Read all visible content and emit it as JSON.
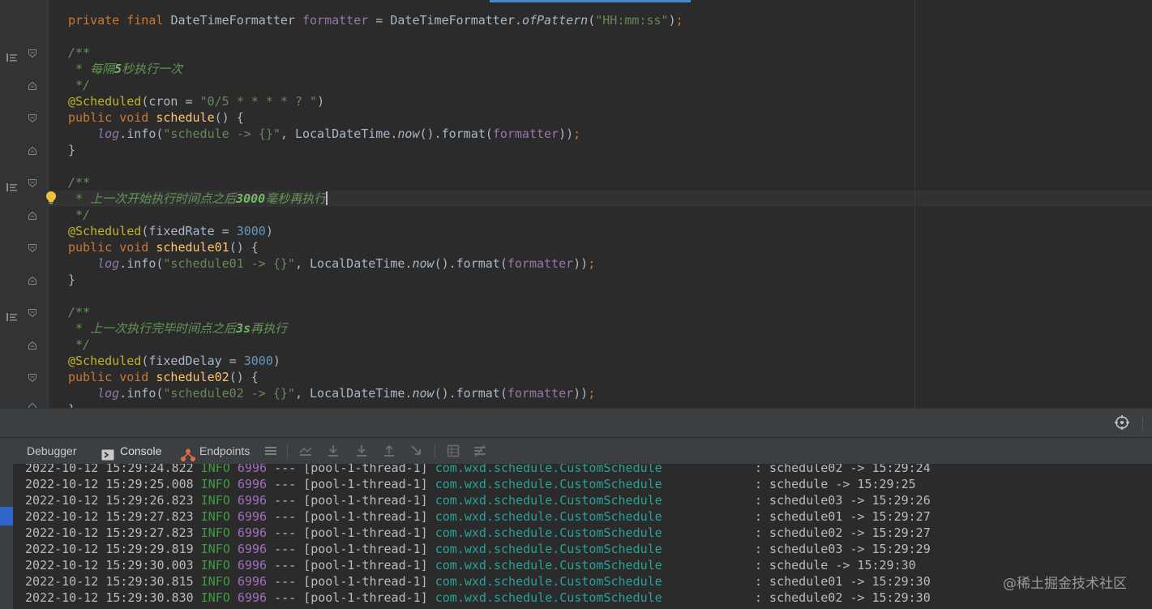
{
  "editor": {
    "lines": [
      [
        {
          "t": "private final ",
          "c": "kw"
        },
        {
          "t": "DateTimeFormatter ",
          "c": ""
        },
        {
          "t": "formatter",
          "c": "fld"
        },
        {
          "t": " = DateTimeFormatter.",
          "c": ""
        },
        {
          "t": "ofPattern",
          "c": "ital"
        },
        {
          "t": "(",
          "c": ""
        },
        {
          "t": "\"HH:mm:ss\"",
          "c": "str"
        },
        {
          "t": ")",
          "c": ""
        },
        {
          "t": ";",
          "c": "kw"
        }
      ],
      [],
      [
        {
          "t": "/**",
          "c": "cmt"
        }
      ],
      [
        {
          "t": " * 每隔",
          "c": "cmt"
        },
        {
          "t": "5",
          "c": "cmtb"
        },
        {
          "t": "秒执行一次",
          "c": "cmt"
        }
      ],
      [
        {
          "t": " */",
          "c": "cmt"
        }
      ],
      [
        {
          "t": "@Scheduled",
          "c": "ann"
        },
        {
          "t": "(cron = ",
          "c": ""
        },
        {
          "t": "\"0/5 * * * * ? \"",
          "c": "str"
        },
        {
          "t": ")",
          "c": ""
        }
      ],
      [
        {
          "t": "public void ",
          "c": "kw"
        },
        {
          "t": "schedule",
          "c": "fn"
        },
        {
          "t": "() {",
          "c": ""
        }
      ],
      [
        {
          "t": "    ",
          "c": ""
        },
        {
          "t": "log",
          "c": "fldi"
        },
        {
          "t": ".info(",
          "c": ""
        },
        {
          "t": "\"schedule -> {}\"",
          "c": "str"
        },
        {
          "t": ", LocalDateTime.",
          "c": ""
        },
        {
          "t": "now",
          "c": "ital"
        },
        {
          "t": "().format(",
          "c": ""
        },
        {
          "t": "formatter",
          "c": "fld"
        },
        {
          "t": "))",
          "c": ""
        },
        {
          "t": ";",
          "c": "kw"
        }
      ],
      [
        {
          "t": "}",
          "c": ""
        }
      ],
      [],
      [
        {
          "t": "/**",
          "c": "cmt"
        }
      ],
      [
        {
          "t": " * 上一次开始执行时间点之后",
          "c": "cmt"
        },
        {
          "t": "3000",
          "c": "cmtb"
        },
        {
          "t": "毫秒再执行",
          "c": "cmt"
        },
        {
          "t": "",
          "c": "caret"
        }
      ],
      [
        {
          "t": " */",
          "c": "cmt"
        }
      ],
      [
        {
          "t": "@Scheduled",
          "c": "ann"
        },
        {
          "t": "(fixedRate = ",
          "c": ""
        },
        {
          "t": "3000",
          "c": "num"
        },
        {
          "t": ")",
          "c": ""
        }
      ],
      [
        {
          "t": "public void ",
          "c": "kw"
        },
        {
          "t": "schedule01",
          "c": "fn"
        },
        {
          "t": "() {",
          "c": ""
        }
      ],
      [
        {
          "t": "    ",
          "c": ""
        },
        {
          "t": "log",
          "c": "fldi"
        },
        {
          "t": ".info(",
          "c": ""
        },
        {
          "t": "\"schedule01 -> {}\"",
          "c": "str"
        },
        {
          "t": ", LocalDateTime.",
          "c": ""
        },
        {
          "t": "now",
          "c": "ital"
        },
        {
          "t": "().format(",
          "c": ""
        },
        {
          "t": "formatter",
          "c": "fld"
        },
        {
          "t": "))",
          "c": ""
        },
        {
          "t": ";",
          "c": "kw"
        }
      ],
      [
        {
          "t": "}",
          "c": ""
        }
      ],
      [],
      [
        {
          "t": "/**",
          "c": "cmt"
        }
      ],
      [
        {
          "t": " * 上一次执行完毕时间点之后",
          "c": "cmt"
        },
        {
          "t": "3s",
          "c": "cmtb"
        },
        {
          "t": "再执行",
          "c": "cmt"
        }
      ],
      [
        {
          "t": " */",
          "c": "cmt"
        }
      ],
      [
        {
          "t": "@Scheduled",
          "c": "ann"
        },
        {
          "t": "(fixedDelay = ",
          "c": ""
        },
        {
          "t": "3000",
          "c": "num"
        },
        {
          "t": ")",
          "c": ""
        }
      ],
      [
        {
          "t": "public void ",
          "c": "kw"
        },
        {
          "t": "schedule02",
          "c": "fn"
        },
        {
          "t": "() {",
          "c": ""
        }
      ],
      [
        {
          "t": "    ",
          "c": ""
        },
        {
          "t": "log",
          "c": "fldi"
        },
        {
          "t": ".info(",
          "c": ""
        },
        {
          "t": "\"schedule02 -> {}\"",
          "c": "str"
        },
        {
          "t": ", LocalDateTime.",
          "c": ""
        },
        {
          "t": "now",
          "c": "ital"
        },
        {
          "t": "().format(",
          "c": ""
        },
        {
          "t": "formatter",
          "c": "fld"
        },
        {
          "t": "))",
          "c": ""
        },
        {
          "t": ";",
          "c": "kw"
        }
      ],
      [
        {
          "t": "}",
          "c": ""
        }
      ]
    ]
  },
  "panel": {
    "tabs": {
      "debugger": "Debugger",
      "console": "Console",
      "endpoints": "Endpoints"
    }
  },
  "console": {
    "rows": [
      {
        "ts": "2022-10-12 15:29:24.822",
        "level": "INFO",
        "pid": "6996",
        "sep": "---",
        "thread": "[pool-1-thread-1]",
        "cls": "com.wxd.schedule.CustomSchedule",
        "msg": ": schedule02 -> 15:29:24"
      },
      {
        "ts": "2022-10-12 15:29:25.008",
        "level": "INFO",
        "pid": "6996",
        "sep": "---",
        "thread": "[pool-1-thread-1]",
        "cls": "com.wxd.schedule.CustomSchedule",
        "msg": ": schedule -> 15:29:25"
      },
      {
        "ts": "2022-10-12 15:29:26.823",
        "level": "INFO",
        "pid": "6996",
        "sep": "---",
        "thread": "[pool-1-thread-1]",
        "cls": "com.wxd.schedule.CustomSchedule",
        "msg": ": schedule03 -> 15:29:26"
      },
      {
        "ts": "2022-10-12 15:29:27.823",
        "level": "INFO",
        "pid": "6996",
        "sep": "---",
        "thread": "[pool-1-thread-1]",
        "cls": "com.wxd.schedule.CustomSchedule",
        "msg": ": schedule01 -> 15:29:27"
      },
      {
        "ts": "2022-10-12 15:29:27.823",
        "level": "INFO",
        "pid": "6996",
        "sep": "---",
        "thread": "[pool-1-thread-1]",
        "cls": "com.wxd.schedule.CustomSchedule",
        "msg": ": schedule02 -> 15:29:27"
      },
      {
        "ts": "2022-10-12 15:29:29.819",
        "level": "INFO",
        "pid": "6996",
        "sep": "---",
        "thread": "[pool-1-thread-1]",
        "cls": "com.wxd.schedule.CustomSchedule",
        "msg": ": schedule03 -> 15:29:29"
      },
      {
        "ts": "2022-10-12 15:29:30.003",
        "level": "INFO",
        "pid": "6996",
        "sep": "---",
        "thread": "[pool-1-thread-1]",
        "cls": "com.wxd.schedule.CustomSchedule",
        "msg": ": schedule -> 15:29:30"
      },
      {
        "ts": "2022-10-12 15:29:30.815",
        "level": "INFO",
        "pid": "6996",
        "sep": "---",
        "thread": "[pool-1-thread-1]",
        "cls": "com.wxd.schedule.CustomSchedule",
        "msg": ": schedule01 -> 15:29:30"
      },
      {
        "ts": "2022-10-12 15:29:30.830",
        "level": "INFO",
        "pid": "6996",
        "sep": "---",
        "thread": "[pool-1-thread-1]",
        "cls": "com.wxd.schedule.CustomSchedule",
        "msg": ": schedule02 -> 15:29:30"
      }
    ]
  },
  "watermark": "@稀土掘金技术社区",
  "colors": {
    "background": "#2b2b2b",
    "keyword": "#cc7832",
    "string": "#6a8759",
    "comment": "#629755",
    "annotation": "#bbb529",
    "method": "#ffc66d",
    "field": "#9876aa",
    "log_info": "#3d9c3d",
    "log_class": "#2aa198"
  }
}
